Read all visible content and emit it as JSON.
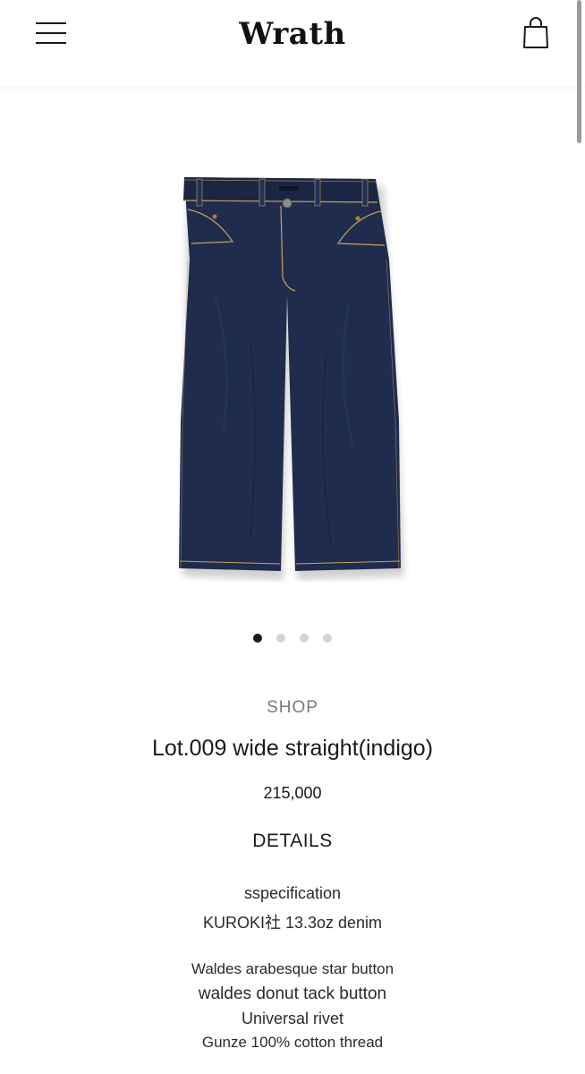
{
  "header": {
    "logo": "Wrath",
    "menu_icon": "hamburger-menu-icon",
    "cart_icon": "shopping-bag-icon"
  },
  "gallery": {
    "image_subject": "indigo wide straight denim jeans",
    "slide_count": 4,
    "active_slide": 1
  },
  "product": {
    "category": "SHOP",
    "title": "Lot.009 wide straight(indigo)",
    "price": "215,000",
    "details_heading": "DETAILS",
    "spec_lines": [
      "sspecification",
      "KUROKI社 13.3oz denim",
      "Waldes arabesque star button",
      "waldes donut tack button",
      "Universal rivet",
      "Gunze 100% cotton thread"
    ]
  },
  "colors": {
    "denim": "#1f2c4d",
    "stitch": "#c9a15a",
    "text": "#1a1a1a",
    "muted": "#7a7a7a",
    "dot_inactive": "#d4d4d4"
  }
}
